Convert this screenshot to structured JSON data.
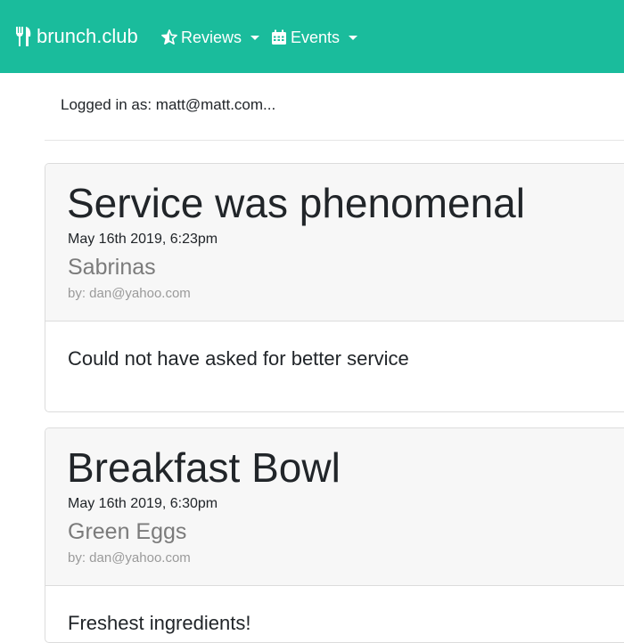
{
  "navbar": {
    "brand": "brunch.club",
    "brand_icon": "utensils-icon",
    "items": [
      {
        "label": "Reviews",
        "icon": "star-half-icon"
      },
      {
        "label": "Events",
        "icon": "calendar-icon"
      }
    ],
    "bg_color": "#1abc9c"
  },
  "user": {
    "logged_in_text": "Logged in as: matt@matt.com..."
  },
  "reviews": [
    {
      "title": "Service was phenomenal",
      "date": "May 16th 2019, 6:23pm",
      "place": "Sabrinas",
      "author": "by: dan@yahoo.com",
      "body": "Could not have asked for better service"
    },
    {
      "title": "Breakfast Bowl",
      "date": "May 16th 2019, 6:30pm",
      "place": "Green Eggs",
      "author": "by: dan@yahoo.com",
      "body": "Freshest ingredients!"
    }
  ]
}
